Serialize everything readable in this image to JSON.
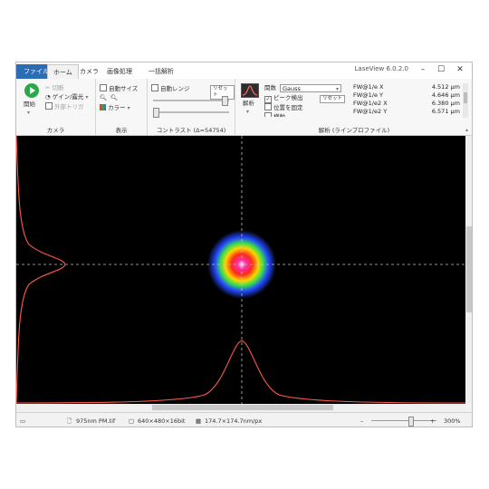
{
  "app": {
    "title": "LaseView 6.0.2.0"
  },
  "menu": {
    "tabs": [
      "ファイル",
      "ホーム",
      "カメラ",
      "画像処理",
      "一括解析"
    ]
  },
  "ribbon": {
    "camera": {
      "start_label": "開始",
      "cut_label": "切断",
      "gain_label": "ゲイン/露光",
      "trigger_label": "外部トリガ",
      "group_label": "カメラ"
    },
    "display": {
      "auto_size_label": "自動サイズ",
      "color_label": "カラー",
      "group_label": "表示"
    },
    "contrast": {
      "auto_range_label": "自動レンジ",
      "reset_label": "リセット",
      "group_label": "コントラスト (Δ=54754)",
      "slider1_fraction": 0.95,
      "slider2_fraction": 0.0
    },
    "analysis": {
      "analyze_label": "解析",
      "function_label": "関数",
      "function_value": "Gauss",
      "peak_detect_label": "ピーク検出",
      "peak_detect_checked": true,
      "fix_position_label": "位置を固定",
      "fix_position_checked": false,
      "extra_label": "横軸",
      "reset_label": "リセット",
      "group_label": "解析 (ラインプロファイル)",
      "results": [
        {
          "label": "FW@1/e X",
          "value": "4.512 μm"
        },
        {
          "label": "FW@1/e Y",
          "value": "4.646 μm"
        },
        {
          "label": "FW@1/e2 X",
          "value": "6.380 μm"
        },
        {
          "label": "FW@1/e2 Y",
          "value": "6.571 μm"
        }
      ]
    }
  },
  "status": {
    "file": "975nm PM.tif",
    "resolution": "640×480×16bit",
    "pixel_size": "174.7×174.7nm/px",
    "zoom": "300%",
    "zoom_fraction": 0.6
  },
  "colors": {
    "profile": "#ff5a4a",
    "crosshair": "#bfbfbf",
    "file_tab": "#2b6cb5",
    "start": "#2aa84a"
  }
}
